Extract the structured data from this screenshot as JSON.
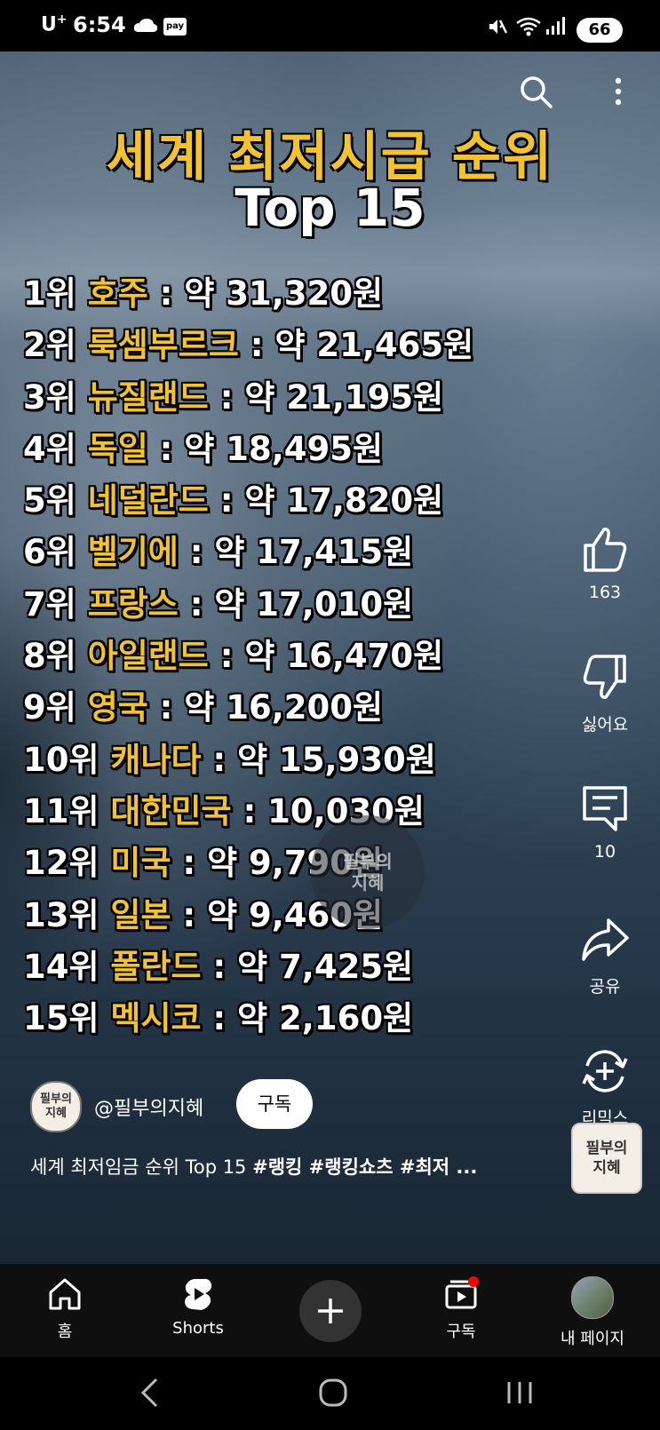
{
  "status_bar": {
    "carrier": "U",
    "carrier_plus": "+",
    "time": "6:54",
    "pay_label": "pay",
    "battery": "66"
  },
  "video": {
    "title_line1": "세계 최저시급 순위",
    "title_line2": "Top 15",
    "watermark": "필부의\n지혜",
    "rankings": [
      {
        "rank": "1위",
        "country": "호주",
        "value": " : 약 31,320원"
      },
      {
        "rank": "2위",
        "country": "룩셈부르크",
        "value": " : 약 21,465원"
      },
      {
        "rank": "3위",
        "country": "뉴질랜드",
        "value": " : 약 21,195원"
      },
      {
        "rank": "4위",
        "country": "독일",
        "value": " : 약 18,495원"
      },
      {
        "rank": "5위",
        "country": "네덜란드",
        "value": " : 약 17,820원"
      },
      {
        "rank": "6위",
        "country": "벨기에",
        "value": " : 약 17,415원"
      },
      {
        "rank": "7위",
        "country": "프랑스",
        "value": " : 약 17,010원"
      },
      {
        "rank": "8위",
        "country": "아일랜드",
        "value": " : 약 16,470원"
      },
      {
        "rank": "9위",
        "country": "영국",
        "value": " : 약 16,200원"
      },
      {
        "rank": "10위",
        "country": "캐나다",
        "value": " : 약 15,930원"
      },
      {
        "rank": "11위",
        "country": "대한민국",
        "value": " : 10,030원"
      },
      {
        "rank": "12위",
        "country": "미국",
        "value": " : 약 9,790원"
      },
      {
        "rank": "13위",
        "country": "일본",
        "value": " : 약 9,460원"
      },
      {
        "rank": "14위",
        "country": "폴란드",
        "value": " : 약 7,425원"
      },
      {
        "rank": "15위",
        "country": "멕시코",
        "value": " : 약 2,160원"
      }
    ]
  },
  "actions": {
    "like_count": "163",
    "dislike_label": "싫어요",
    "comment_count": "10",
    "share_label": "공유",
    "remix_label": "리믹스"
  },
  "channel": {
    "avatar_text": "필부의\n지혜",
    "handle": "@필부의지혜",
    "subscribe_label": "구독",
    "caption_text": "세계 최저임금 순위 Top 15 ",
    "caption_tags": "#랭킹 #랭킹쇼츠 #최저 ...",
    "remix_thumb_text": "필부의\n지혜"
  },
  "bottom_nav": {
    "home_label": "홈",
    "shorts_label": "Shorts",
    "subscriptions_label": "구독",
    "profile_label": "내 페이지"
  },
  "colors": {
    "title_accent": "#f2c230",
    "notification_dot": "#ff0000"
  }
}
